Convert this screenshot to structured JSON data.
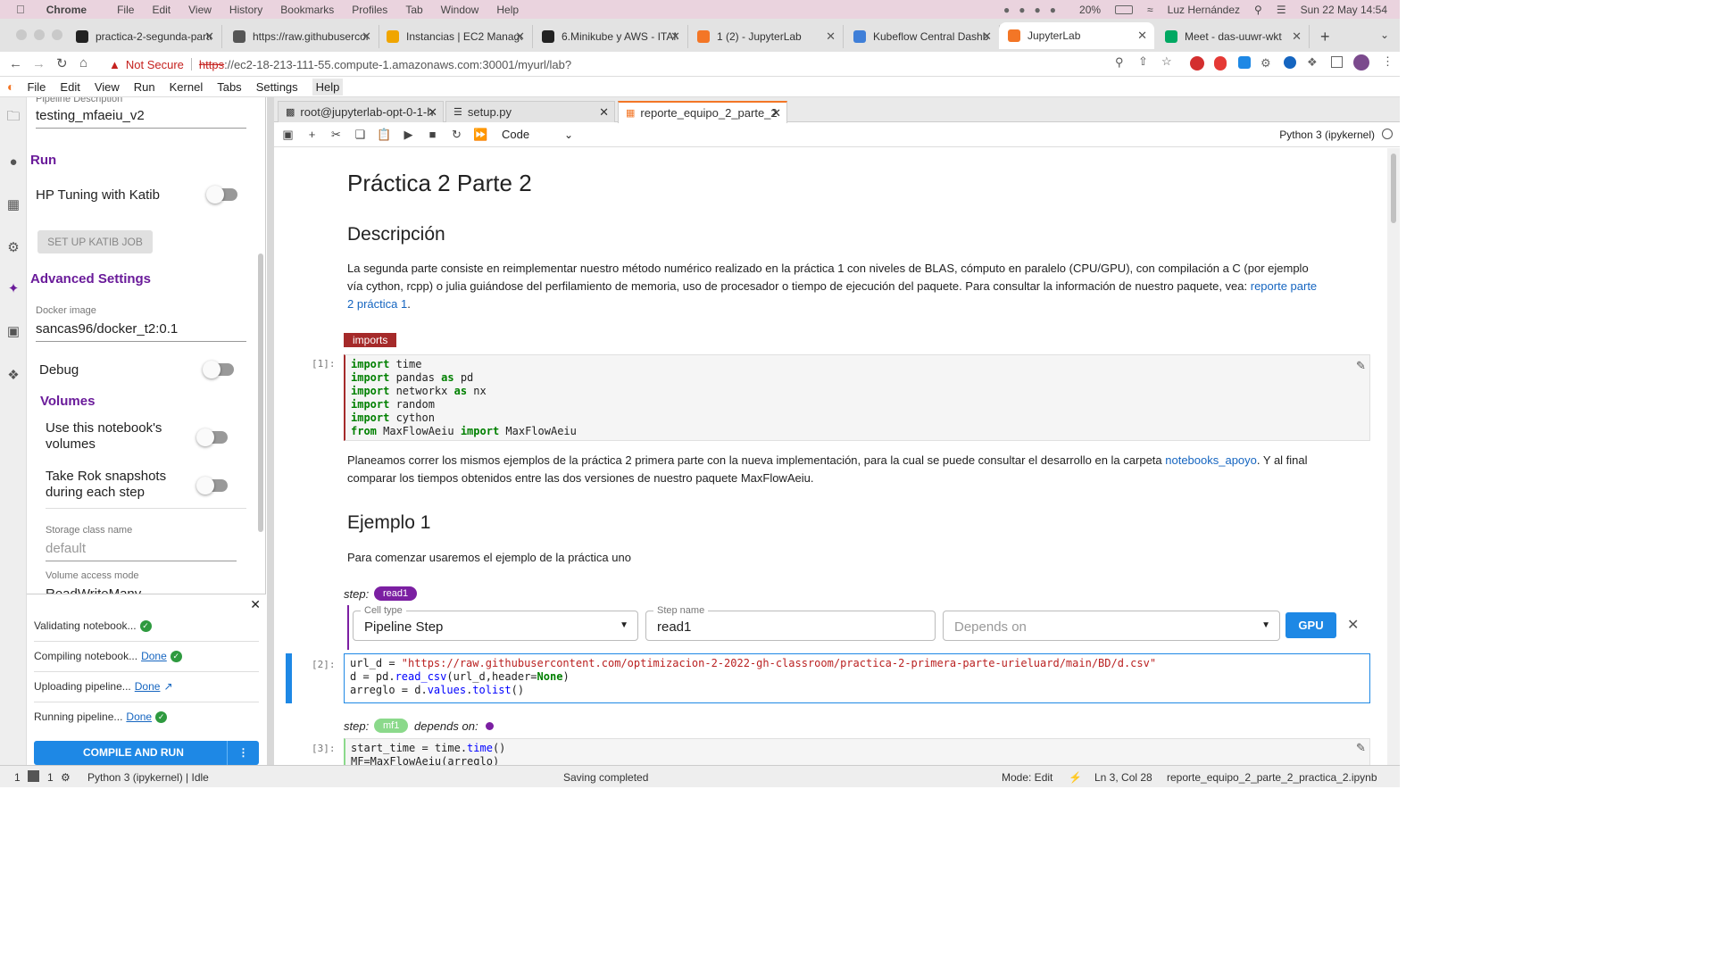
{
  "macos": {
    "app": "Chrome",
    "menus": [
      "File",
      "Edit",
      "View",
      "History",
      "Bookmarks",
      "Profiles",
      "Tab",
      "Window",
      "Help"
    ],
    "battery": "20%",
    "user": "Luz Hernández",
    "datetime": "Sun 22 May  14:54"
  },
  "browser_tabs": [
    {
      "title": "practica-2-segunda-parte",
      "color": "#222222"
    },
    {
      "title": "https://raw.githubuserconte",
      "color": "#555555"
    },
    {
      "title": "Instancias | EC2 Managem",
      "color": "#f0a500"
    },
    {
      "title": "6.Minikube y AWS - ITAM-",
      "color": "#222222"
    },
    {
      "title": "1 (2) - JupyterLab",
      "color": "#f37626"
    },
    {
      "title": "Kubeflow Central Dashboa",
      "color": "#3f7fd8"
    },
    {
      "title": "JupyterLab",
      "color": "#f37626"
    },
    {
      "title": "Meet - das-uuwr-wkt",
      "color": "#00a862"
    }
  ],
  "address": {
    "security": "Not Secure",
    "scheme": "https",
    "url": "://ec2-18-213-111-55.compute-1.amazonaws.com:30001/myurl/lab?"
  },
  "jupyter_menu": [
    "File",
    "Edit",
    "View",
    "Run",
    "Kernel",
    "Tabs",
    "Settings",
    "Help"
  ],
  "panel": {
    "pipeline_description_label": "Pipeline Description",
    "pipeline_description": "testing_mfaeiu_v2",
    "run_heading": "Run",
    "hp_tuning": "HP Tuning with Katib",
    "katib_button": "SET UP KATIB JOB",
    "advanced": "Advanced Settings",
    "docker_label": "Docker image",
    "docker_value": "sancas96/docker_t2:0.1",
    "debug": "Debug",
    "volumes": "Volumes",
    "use_volumes": "Use this notebook's volumes",
    "rok": "Take Rok snapshots during each step",
    "storage_label": "Storage class name",
    "storage_value": "default",
    "access_label": "Volume access mode",
    "access_value": "ReadWriteMany"
  },
  "progress": {
    "validating": "Validating notebook...",
    "compiling": "Compiling notebook...",
    "uploading": "Uploading pipeline...",
    "running": "Running pipeline...",
    "done": "Done",
    "compile_button": "COMPILE AND RUN"
  },
  "doc_tabs": [
    {
      "title": "root@jupyterlab-opt-0-1-h"
    },
    {
      "title": "setup.py"
    },
    {
      "title": "reporte_equipo_2_parte_2"
    }
  ],
  "toolbar": {
    "cell_type": "Code",
    "kernel": "Python 3 (ipykernel)"
  },
  "notebook": {
    "title": "Práctica 2 Parte 2",
    "descripcion_h": "Descripción",
    "descripcion_p": "La segunda parte consiste en reimplementar nuestro método numérico realizado en la práctica 1 con niveles de BLAS, cómputo en paralelo (CPU/GPU), con compilación a C (por ejemplo vía cython, rcpp) o julia guiándose del perfilamiento de memoria, uso de procesador o tiempo de ejecución del paquete. Para consultar la información de nuestro paquete, vea: ",
    "descripcion_link": "reporte parte 2 práctica 1",
    "imports_tag": "imports",
    "prompt1": "[1]:",
    "planeamos_p": "Planeamos correr los mismos ejemplos de la práctica 2 primera parte con la nueva implementación, para la cual se puede consultar el desarrollo en la carpeta ",
    "planeamos_link": "notebooks_apoyo",
    "planeamos_p2": ". Y al final comparar los tiempos obtenidos entre las dos versiones de nuestro paquete MaxFlowAeiu.",
    "ejemplo_h": "Ejemplo 1",
    "ejemplo_p": "Para comenzar usaremos el ejemplo de la práctica uno",
    "step_label": "step:",
    "step1": "read1",
    "cell_type_label": "Cell type",
    "cell_type_value": "Pipeline Step",
    "step_name_label": "Step name",
    "step_name_value": "read1",
    "depends_placeholder": "Depends on",
    "gpu": "GPU",
    "prompt2": "[2]:",
    "step2": "mf1",
    "depends_on": "depends on:",
    "prompt3": "[3]:"
  },
  "statusbar": {
    "left1": "1",
    "left2": "1",
    "kernel": "Python 3 (ipykernel) | Idle",
    "saving": "Saving completed",
    "mode": "Mode: Edit",
    "pos": "Ln 3, Col 28",
    "file": "reporte_equipo_2_parte_2_practica_2.ipynb"
  }
}
